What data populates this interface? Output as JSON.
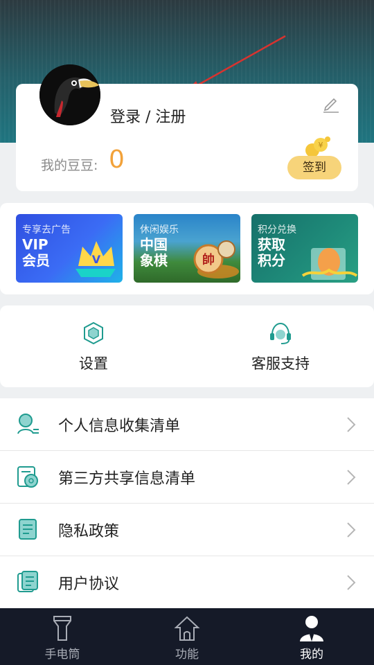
{
  "profile": {
    "login_text": "登录 / 注册",
    "beans_label": "我的豆豆:",
    "beans_value": "0",
    "checkin_label": "签到"
  },
  "banners": [
    {
      "tag": "专享去广告",
      "title_line1": "VIP",
      "title_line2": "会员"
    },
    {
      "tag": "休闲娱乐",
      "title_line1": "中国",
      "title_line2": "象棋"
    },
    {
      "tag": "积分兑换",
      "title_line1": "获取",
      "title_line2": "积分"
    }
  ],
  "tools": [
    {
      "label": "设置",
      "icon": "settings-hexagon-icon"
    },
    {
      "label": "客服支持",
      "icon": "headset-icon"
    }
  ],
  "menu_items": [
    {
      "label": "个人信息收集清单",
      "icon": "person-info-icon"
    },
    {
      "label": "第三方共享信息清单",
      "icon": "shared-info-icon"
    },
    {
      "label": "隐私政策",
      "icon": "privacy-document-icon"
    },
    {
      "label": "用户协议",
      "icon": "agreement-document-icon"
    }
  ],
  "bottom_nav": [
    {
      "label": "手电筒",
      "icon": "flashlight-icon",
      "active": false
    },
    {
      "label": "功能",
      "icon": "home-icon",
      "active": false
    },
    {
      "label": "我的",
      "icon": "user-icon",
      "active": true
    }
  ],
  "colors": {
    "accent": "#f2a23a",
    "checkin_bg": "#f7d47a",
    "icon_teal": "#1f9b8f",
    "nav_bg": "#151a28"
  }
}
